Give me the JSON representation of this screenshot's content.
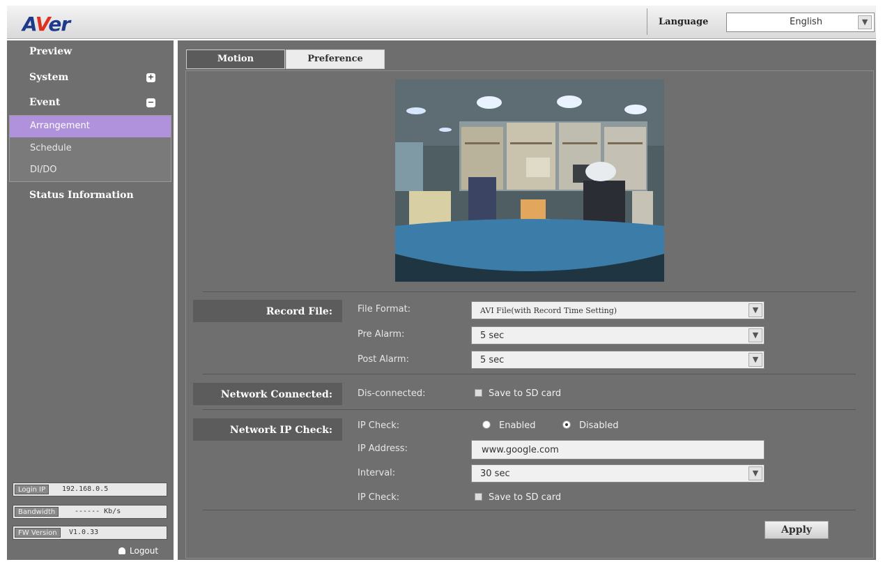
{
  "header": {
    "logo_prefix": "A",
    "logo_v": "V",
    "logo_suffix": "er",
    "language_label": "Language",
    "language_value": "English",
    "brand_color": "#1d3a8c"
  },
  "sidebar": {
    "items": [
      {
        "label": "Preview"
      },
      {
        "label": "System",
        "toggle": "+"
      },
      {
        "label": "Event",
        "toggle": "−"
      },
      {
        "label": "Status Information"
      }
    ],
    "event_sub": [
      {
        "label": "Arrangement",
        "active": true
      },
      {
        "label": "Schedule"
      },
      {
        "label": "DI/DO"
      }
    ],
    "active_color": "#b092dc",
    "info": {
      "login_ip_label": "Login IP",
      "login_ip_value": "192.168.0.5",
      "bandwidth_label": "Bandwidth",
      "bandwidth_value": "------ Kb/s",
      "fw_label": "FW Version",
      "fw_value": "V1.0.33"
    },
    "logout": "Logout"
  },
  "tabs": {
    "motion": "Motion",
    "preference": "Preference"
  },
  "record_file": {
    "heading": "Record File:",
    "file_format_label": "File Format:",
    "file_format_value": "AVI File(with Record Time Setting)",
    "pre_alarm_label": "Pre Alarm:",
    "pre_alarm_value": "5 sec",
    "post_alarm_label": "Post Alarm:",
    "post_alarm_value": "5 sec"
  },
  "network_connected": {
    "heading": "Network Connected:",
    "disconnected_label": "Dis-connected:",
    "save_sd": "Save to SD card"
  },
  "network_ip_check": {
    "heading": "Network IP Check:",
    "ip_check_label": "IP Check:",
    "enabled": "Enabled",
    "disabled": "Disabled",
    "selected": "Disabled",
    "ip_address_label": "IP Address:",
    "ip_address_value": "www.google.com",
    "interval_label": "Interval:",
    "interval_value": "30 sec",
    "ip_check_label_2": "IP Check:",
    "save_sd": "Save to SD card"
  },
  "apply": "Apply"
}
